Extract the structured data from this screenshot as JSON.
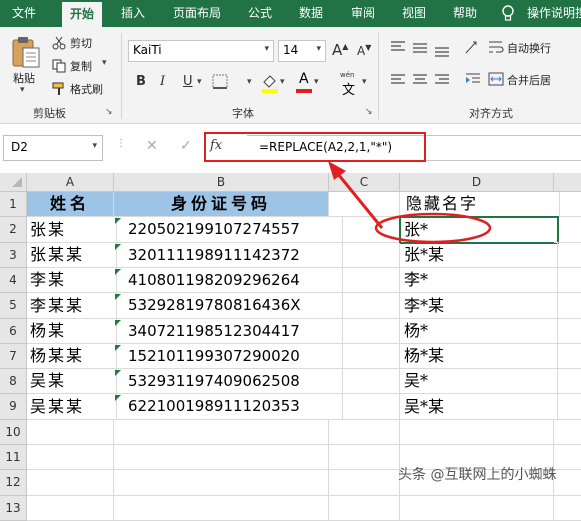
{
  "tabs": [
    "文件",
    "开始",
    "插入",
    "页面布局",
    "公式",
    "数据",
    "审阅",
    "视图",
    "帮助",
    "操作说明搜"
  ],
  "clipboard": {
    "paste": "粘贴",
    "cut": "剪切",
    "copy": "复制",
    "format_painter": "格式刷",
    "group_title": "剪贴板"
  },
  "font": {
    "name": "KaiTi",
    "size": "14",
    "grow": "A",
    "shrink": "A",
    "bold": "B",
    "italic": "I",
    "underline": "U",
    "font_color": "A",
    "phonetic": "文",
    "group_title": "字体"
  },
  "alignment": {
    "wrap": "自动换行",
    "merge": "合并后居",
    "group_title": "对齐方式"
  },
  "formula_bar": {
    "name_box": "D2",
    "fx": "fx",
    "formula": "=REPLACE(A2,2,1,\"*\")"
  },
  "sheet": {
    "columns": [
      "A",
      "B",
      "C",
      "D"
    ],
    "rows": [
      "1",
      "2",
      "3",
      "4",
      "5",
      "6",
      "7",
      "8",
      "9",
      "10",
      "11",
      "12",
      "13"
    ],
    "header": {
      "a": "姓名",
      "b": "身份证号码",
      "d": "隐藏名字"
    },
    "data": [
      {
        "name": "张某",
        "id": "220502199107274557",
        "hidden": "张*"
      },
      {
        "name": "张某某",
        "id": "320111198911142372",
        "hidden": "张*某"
      },
      {
        "name": "李某",
        "id": "410801198209296264",
        "hidden": "李*"
      },
      {
        "name": "李某某",
        "id": "53292819780816436X",
        "hidden": "李*某"
      },
      {
        "name": "杨某",
        "id": "340721198512304417",
        "hidden": "杨*"
      },
      {
        "name": "杨某某",
        "id": "152101199307290020",
        "hidden": "杨*某"
      },
      {
        "name": "吴某",
        "id": "532931197409062508",
        "hidden": "吴*"
      },
      {
        "name": "吴某某",
        "id": "622100198911120353",
        "hidden": "吴*某"
      }
    ]
  },
  "watermark": "头条 @互联网上的小蜘蛛",
  "colors": {
    "ribbon_green": "#217346",
    "header_fill": "#9dc3e6",
    "annotation_red": "#e02020"
  }
}
